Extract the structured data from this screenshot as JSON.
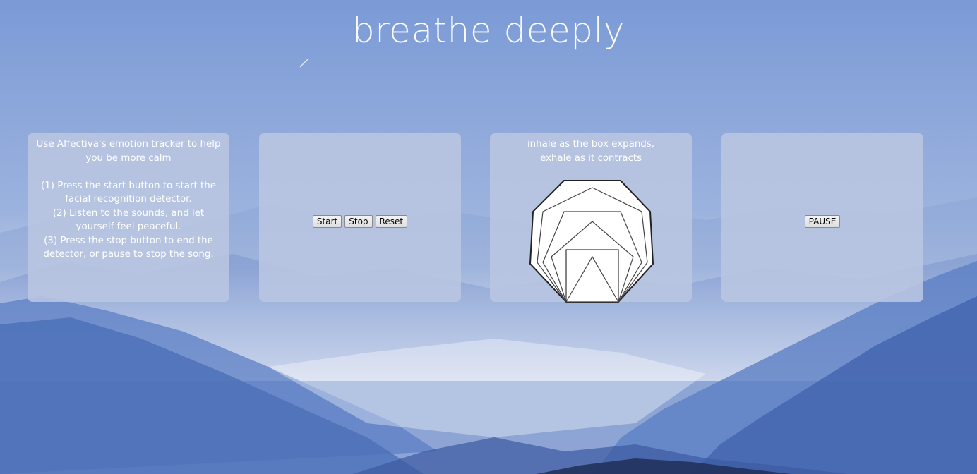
{
  "header": {
    "title": "breathe deeply"
  },
  "instructions": {
    "intro": "Use Affectiva's emotion tracker to help you be more calm",
    "steps": [
      "(1) Press the start button to start the facial recognition detector.",
      "(2) Listen to the sounds, and let yourself feel peaceful.",
      "(3) Press the stop button to end the detector, or pause to stop the song."
    ]
  },
  "controls": {
    "start_label": "Start",
    "stop_label": "Stop",
    "reset_label": "Reset"
  },
  "breathing": {
    "caption_line1": "inhale as the box expands,",
    "caption_line2": "exhale as it contracts"
  },
  "music": {
    "pause_label": "PAUSE"
  },
  "colors": {
    "sky_top": "#7c9bd4",
    "panel_bg": "#b9c6e1",
    "text": "#ffffff"
  }
}
